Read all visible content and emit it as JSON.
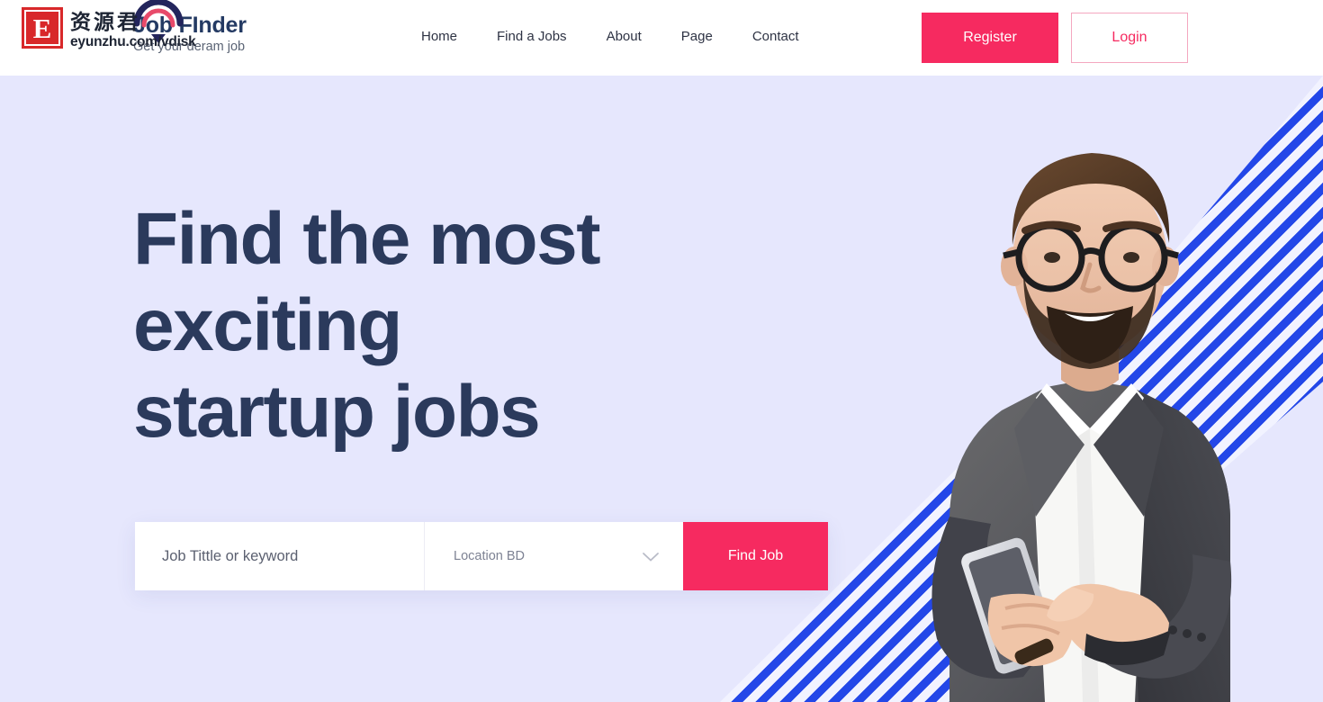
{
  "brand": {
    "title": "Job FInder",
    "tagline": "Get your deram job",
    "mark_icon": "circular-arc-logo-icon"
  },
  "nav": {
    "items": [
      {
        "label": "Home",
        "name": "nav-item-home"
      },
      {
        "label": "Find a Jobs",
        "name": "nav-item-find-a-jobs"
      },
      {
        "label": "About",
        "name": "nav-item-about"
      },
      {
        "label": "Page",
        "name": "nav-item-page"
      },
      {
        "label": "Contact",
        "name": "nav-item-contact"
      }
    ]
  },
  "auth": {
    "register_label": "Register",
    "login_label": "Login"
  },
  "hero": {
    "title_line1": "Find the most",
    "title_line2": "exciting",
    "title_line3": "startup jobs",
    "title_full": "Find the most exciting startup jobs"
  },
  "search": {
    "keyword_value": "",
    "keyword_placeholder": "Job Tittle or keyword",
    "location_selected": "Location BD",
    "location_chevron_icon": "chevron-down-icon",
    "find_label": "Find Job"
  },
  "watermark": {
    "badge_letter": "E",
    "chinese": "资源君",
    "url": "eyunzhu.com/vdisk"
  },
  "colors": {
    "accent_pink": "#f62a60",
    "stripe_blue": "#2347e8",
    "hero_background": "#e6e7fd",
    "heading_navy": "#2b3a5c",
    "header_background": "#ffffff",
    "login_border": "#f4a7c0"
  },
  "illustration": {
    "subject": "smiling-bearded-man-with-glasses-in-grey-suit-holding-smartphone",
    "name": "hero-person-photo"
  }
}
